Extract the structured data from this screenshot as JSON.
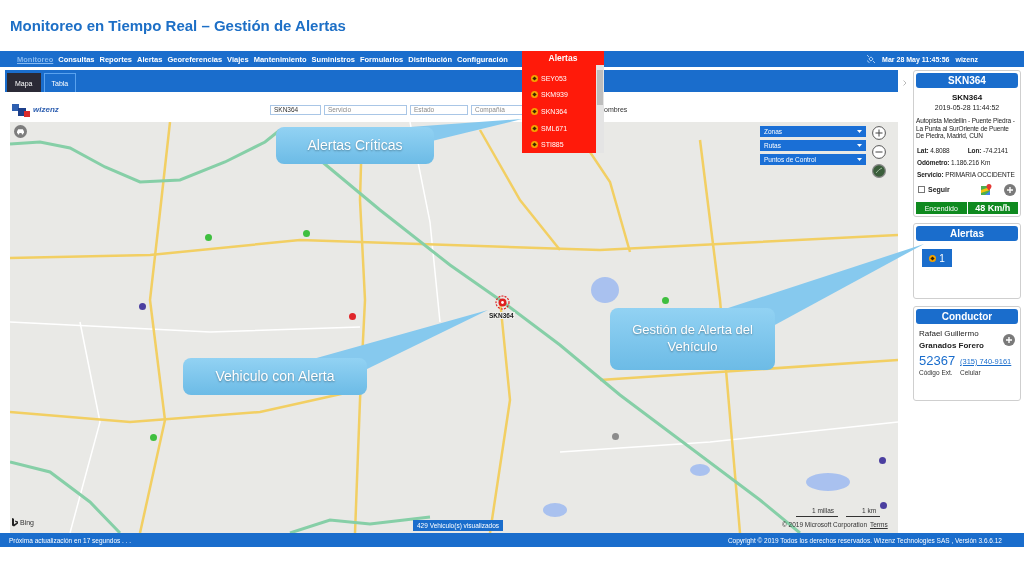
{
  "page_title": "Monitoreo en Tiempo Real – Gestión de Alertas",
  "nav": {
    "items": [
      {
        "label": "Monitoreo",
        "selected": true
      },
      {
        "label": "Consultas",
        "selected": false
      },
      {
        "label": "Reportes",
        "selected": false
      },
      {
        "label": "Alertas",
        "selected": false
      },
      {
        "label": "Georeferencias",
        "selected": false
      },
      {
        "label": "Viajes",
        "selected": false
      },
      {
        "label": "Mantenimiento",
        "selected": false
      },
      {
        "label": "Suministros",
        "selected": false
      },
      {
        "label": "Formularios",
        "selected": false
      },
      {
        "label": "Distribución",
        "selected": false
      },
      {
        "label": "Configuración",
        "selected": false
      }
    ],
    "clock": "Mar 28 May 11:45:56",
    "user": "wizenz"
  },
  "alerts_dropdown": {
    "title": "Alertas",
    "items": [
      "SEY053",
      "SKM939",
      "SKN364",
      "SML671",
      "STI885"
    ]
  },
  "tabs": [
    {
      "label": "Mapa",
      "selected": true
    },
    {
      "label": "Tabla",
      "selected": false
    }
  ],
  "filters": {
    "logo": "wizenz",
    "fields": [
      {
        "value": "SKN364"
      },
      {
        "placeholder": "Servicio"
      },
      {
        "placeholder": "Estado"
      },
      {
        "placeholder": "Compañía"
      }
    ],
    "label": "ombres"
  },
  "map": {
    "layers": [
      "Zonas",
      "Rutas",
      "Puntos de Control"
    ],
    "markers": [
      {
        "color": "#3fbf3f"
      },
      {
        "color": "#3fbf3f"
      },
      {
        "color": "#4b3fa0"
      },
      {
        "color": "#e0262a"
      },
      {
        "color": "#3fbf3f"
      },
      {
        "color": "#8c8c8c"
      },
      {
        "color": "#3fbf3f"
      },
      {
        "color": "#4b3fa0"
      },
      {
        "color": "#4b3fa0"
      }
    ],
    "selected_vehicle": "SKN364",
    "vehicle_count": "429 Vehiculo(s) visualizados",
    "provider": "Bing",
    "scale": [
      "1 millas",
      "1 km"
    ],
    "copyright": "© 2019 Microsoft Corporation",
    "terms": "Terms"
  },
  "callouts": [
    "Alertas Críticas",
    "Vehiculo con Alerta",
    "Gestión de Alerta del Vehículo"
  ],
  "vehicle_panel": {
    "title": "SKN364",
    "plate": "SKN364",
    "timestamp": "2019-05-28 11:44:52",
    "address": "Autopista Medellin - Puente Piedra - La Punta al SurOriente de Puente De Piedra, Madrid, CUN",
    "lat": "**Lat:** 4.8088",
    "lon": "**Lon:** -74.2141",
    "odometer": "**Odómetro:** 1.186.216 Km",
    "service": "**Servicio:** PRIMARIA OCCIDENTE",
    "follow": {
      "label": "Seguir",
      "checked": false
    },
    "status": "Encendido",
    "speed": "48 Km/h"
  },
  "alerts_panel": {
    "title": "Alertas",
    "count": "1"
  },
  "driver_panel": {
    "title": "Conductor",
    "first_names": "Rafael Guillermo",
    "last_names": "Granados Forero",
    "extension": "52367",
    "phone": "(315) 740-9161",
    "extension_label": "Código Ext.",
    "phone_label": "Celular"
  },
  "status_bar": {
    "left": "Próxima actualización en 17 segundos . . .",
    "right": "Copyright © 2019 Todos los derechos reservados. Wizenz Technologies SAS , Versión 3.6.6.12"
  }
}
